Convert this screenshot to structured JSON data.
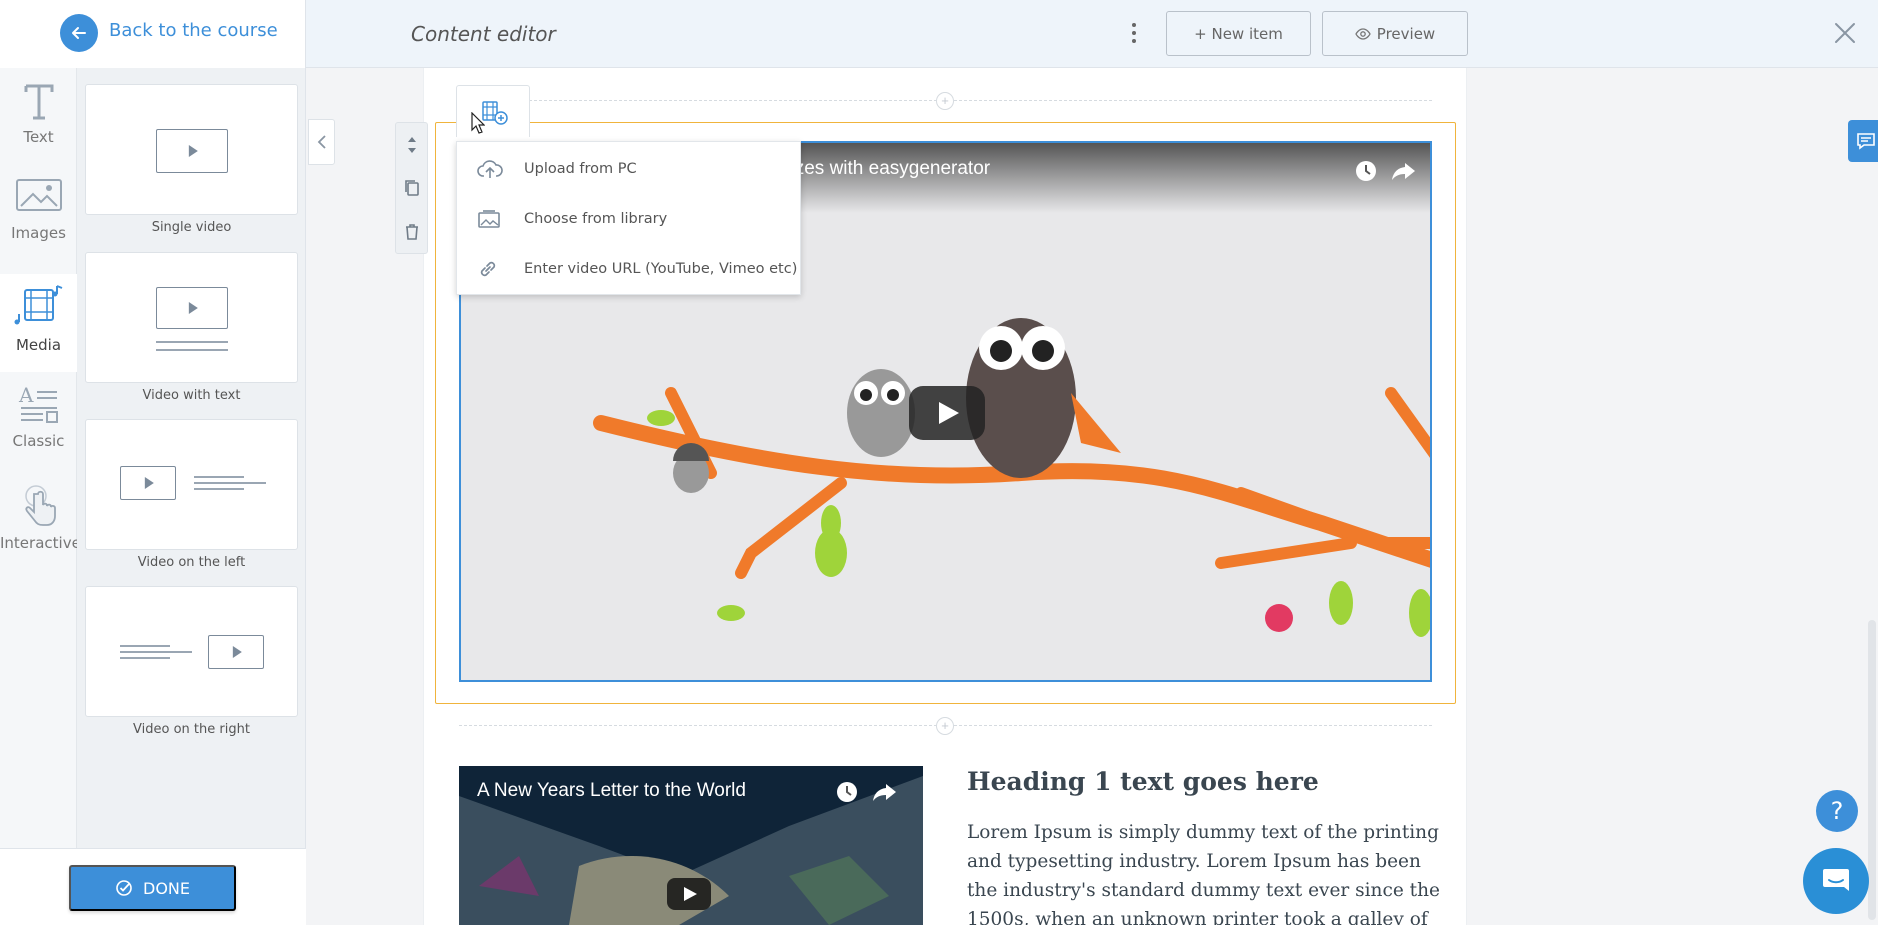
{
  "header": {
    "back_label": "Back to the course",
    "title": "Content editor",
    "new_item_label": "+ New item",
    "preview_label": "Preview"
  },
  "categories": [
    {
      "label": "Text",
      "icon": "text-icon"
    },
    {
      "label": "Images",
      "icon": "image-icon"
    },
    {
      "label": "Media",
      "icon": "media-icon",
      "active": true
    },
    {
      "label": "Classic",
      "icon": "classic-icon"
    },
    {
      "label": "Interactive",
      "icon": "hand-pointer-icon"
    }
  ],
  "templates": [
    {
      "label": "Single video"
    },
    {
      "label": "Video with text"
    },
    {
      "label": "Video on the left"
    },
    {
      "label": "Video on the right"
    }
  ],
  "done_label": "DONE",
  "media_menu": {
    "items": [
      {
        "label": "Upload from PC",
        "icon": "cloud-upload-icon"
      },
      {
        "label": "Choose from library",
        "icon": "image-library-icon"
      },
      {
        "label": "Enter video URL (YouTube, Vimeo etc)",
        "icon": "link-icon"
      }
    ]
  },
  "video_main": {
    "title_visible": "izzes with easygenerator"
  },
  "video_second": {
    "title": "A New Years Letter to the World"
  },
  "text_block": {
    "heading": "Heading 1 text goes here",
    "body": "Lorem Ipsum is simply dummy text of the printing and typesetting industry. Lorem Ipsum has been the industry's standard dummy text ever since the 1500s, when an unknown printer took a galley of"
  },
  "help_label": "?",
  "colors": {
    "accent": "#3d8fd9",
    "selection": "#f0b43c"
  }
}
